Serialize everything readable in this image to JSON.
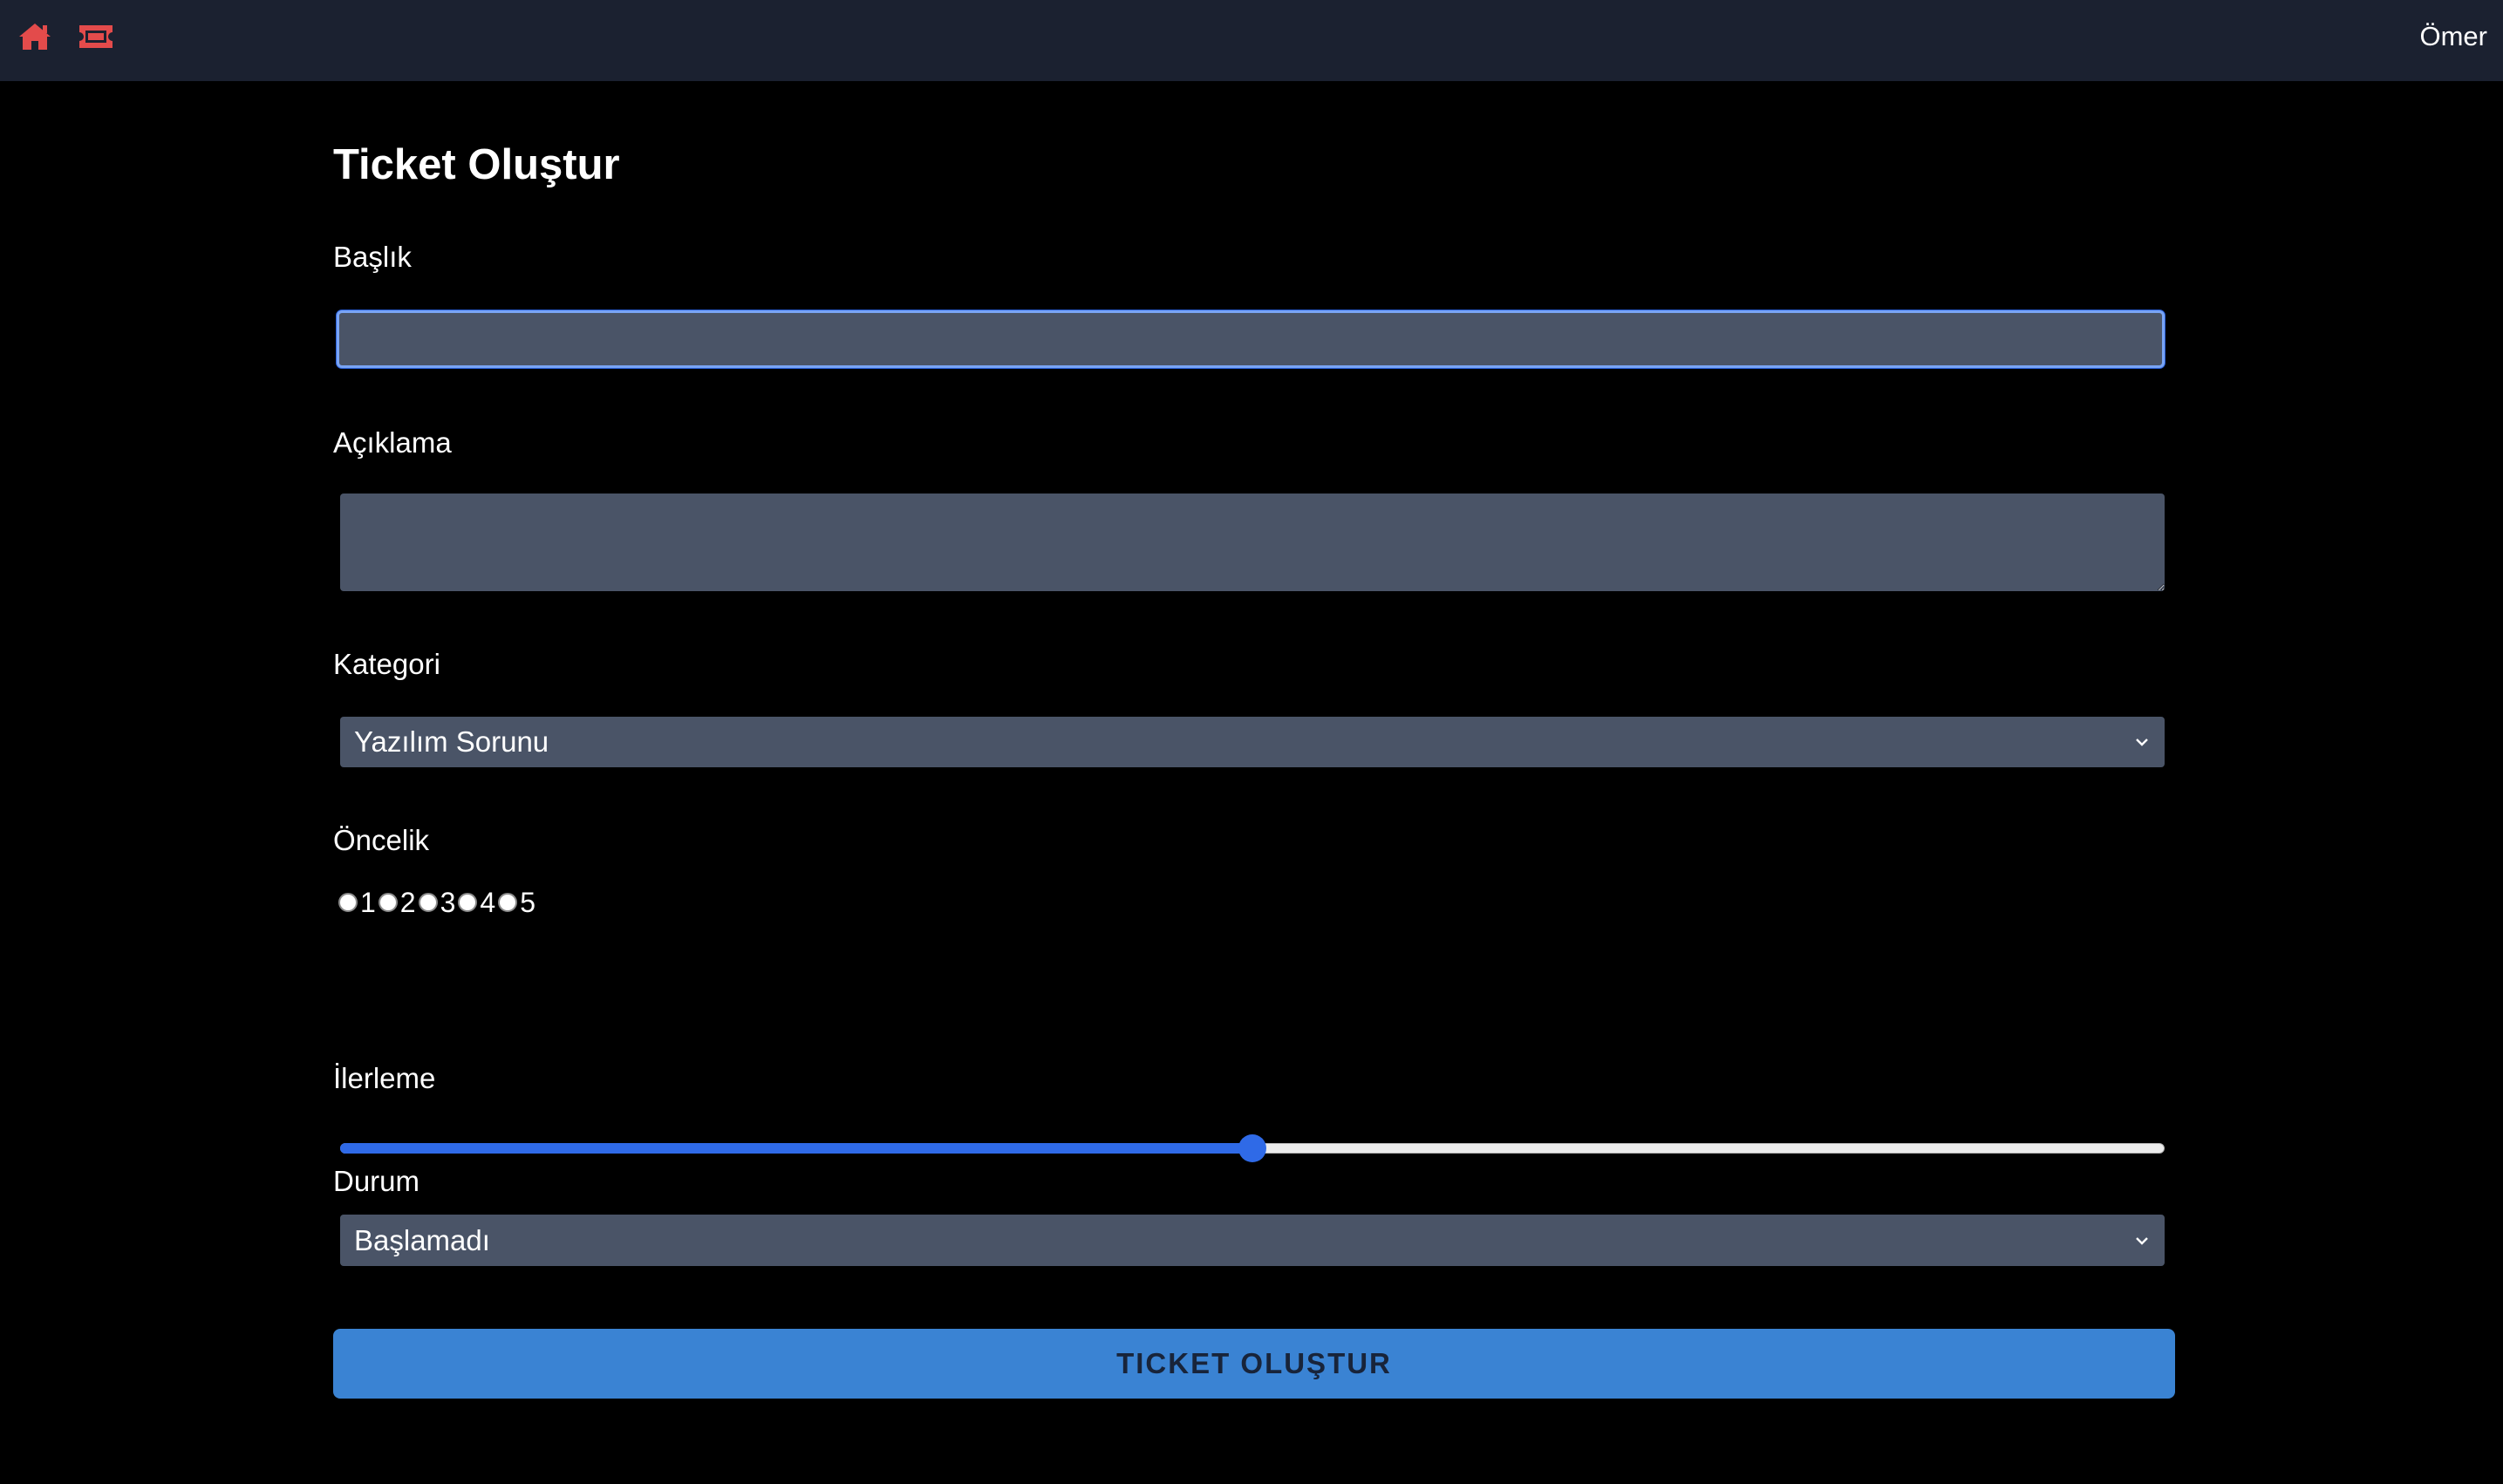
{
  "navbar": {
    "home_icon": "home-icon",
    "ticket_icon": "ticket-icon",
    "user_name": "Ömer",
    "icon_color": "#e34b4b"
  },
  "form": {
    "title": "Ticket Oluştur",
    "title_field": {
      "label": "Başlık",
      "value": ""
    },
    "description_field": {
      "label": "Açıklama",
      "value": ""
    },
    "category_field": {
      "label": "Kategori",
      "selected": "Yazılım Sorunu"
    },
    "priority_field": {
      "label": "Öncelik",
      "options": [
        "1",
        "2",
        "3",
        "4",
        "5"
      ],
      "selected": null
    },
    "progress_field": {
      "label": "İlerleme",
      "value_percent": 50
    },
    "status_field": {
      "label": "Durum",
      "selected": "Başlamadı"
    },
    "submit_label": "TICKET OLUŞTUR"
  },
  "colors": {
    "navbar_bg": "#1b2130",
    "page_bg": "#000000",
    "input_bg": "#4a5467",
    "accent": "#2f6ae7",
    "button_bg": "#3a83d3"
  }
}
